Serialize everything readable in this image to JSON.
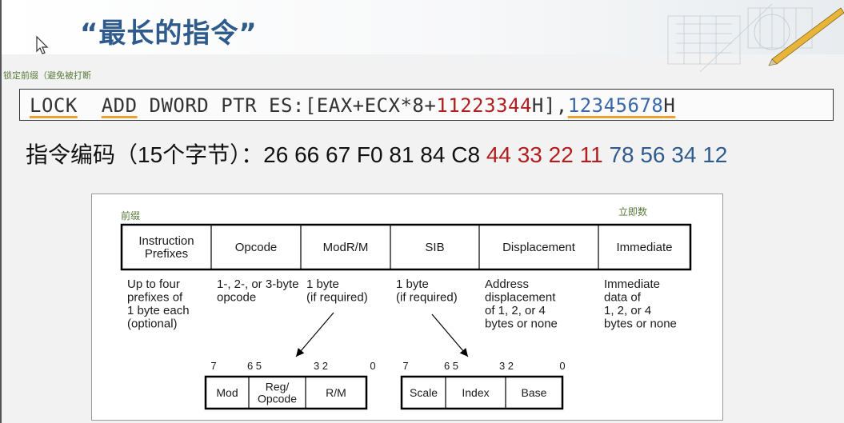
{
  "slide": {
    "title": "“最长的指令”",
    "lock_note": "锁定前缀（避免被打断"
  },
  "assembly": {
    "parts": [
      {
        "text": "LOCK",
        "style": "uline"
      },
      {
        "text": "  ",
        "style": ""
      },
      {
        "text": "ADD",
        "style": "uline"
      },
      {
        "text": " DWORD PTR ES:[EAX+ECX*8+",
        "style": ""
      },
      {
        "text": "11223344",
        "style": "asm-red"
      },
      {
        "text": "H],",
        "style": ""
      },
      {
        "text": "12345678",
        "style": "asm-blue uline"
      },
      {
        "text": "H",
        "style": "uline"
      }
    ]
  },
  "encoding": {
    "label": "指令编码（15个字节）：",
    "bytes_black": "26 66 67 F0 81 84 C8",
    "bytes_red": "44 33 22 11",
    "bytes_blue": "78 56 34 12"
  },
  "figure": {
    "prefix_note": "前缀",
    "immediate_note": "立即数",
    "fields": [
      {
        "name": "Instruction Prefixes",
        "lines": [
          "Instruction",
          "Prefixes"
        ],
        "desc": [
          "Up to four",
          "prefixes of",
          "1 byte each",
          "(optional)"
        ]
      },
      {
        "name": "Opcode",
        "lines": [
          "Opcode"
        ],
        "desc": [
          "1-, 2-, or 3-byte",
          "opcode"
        ]
      },
      {
        "name": "ModR/M",
        "lines": [
          "ModR/M"
        ],
        "desc": [
          "1 byte",
          "(if required)"
        ]
      },
      {
        "name": "SIB",
        "lines": [
          "SIB"
        ],
        "desc": [
          "1 byte",
          "(if required)"
        ]
      },
      {
        "name": "Displacement",
        "lines": [
          "Displacement"
        ],
        "desc": [
          "Address",
          "displacement",
          "of 1, 2, or 4",
          "bytes or none"
        ]
      },
      {
        "name": "Immediate",
        "lines": [
          "Immediate"
        ],
        "desc": [
          "Immediate",
          "data of",
          "1, 2, or 4",
          "bytes or none"
        ]
      }
    ],
    "modrm": {
      "bits": [
        "7",
        "6 5",
        "3 2",
        "0"
      ],
      "fields": [
        {
          "name": "Mod",
          "lines": [
            "Mod"
          ]
        },
        {
          "name": "Reg/Opcode",
          "lines": [
            "Reg/",
            "Opcode"
          ]
        },
        {
          "name": "R/M",
          "lines": [
            "R/M"
          ]
        }
      ]
    },
    "sib": {
      "bits": [
        "7",
        "6 5",
        "3 2",
        "0"
      ],
      "fields": [
        {
          "name": "Scale",
          "lines": [
            "Scale"
          ]
        },
        {
          "name": "Index",
          "lines": [
            "Index"
          ]
        },
        {
          "name": "Base",
          "lines": [
            "Base"
          ]
        }
      ]
    }
  }
}
